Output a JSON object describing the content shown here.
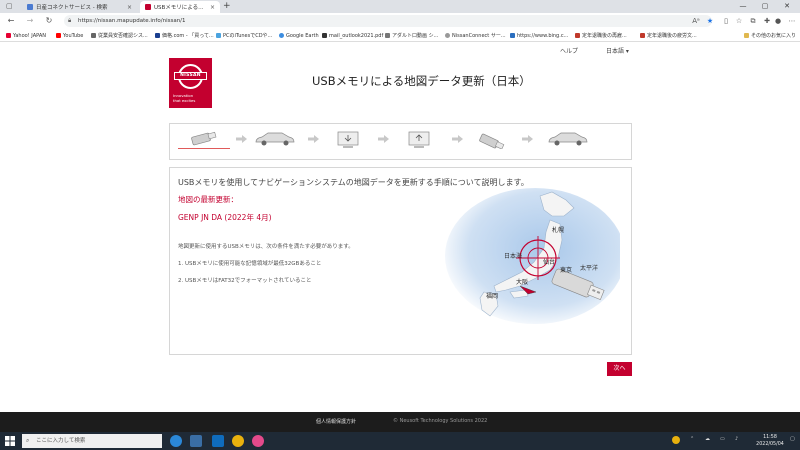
{
  "browser": {
    "tabs": [
      {
        "title": "日産コネクトサービス - 検索"
      },
      {
        "title": "USBメモリによる地図データ更新（日…"
      }
    ],
    "new_tab": "+",
    "url": "https://nissan.mapupdate.info/nissan/1",
    "bookmarks": [
      {
        "label": "Yahoo! JAPAN",
        "color": "#e60033"
      },
      {
        "label": "YouTube",
        "color": "#ff0000"
      },
      {
        "label": "従業員安否確認シス...",
        "color": "#666666"
      },
      {
        "label": "価格.com - 「買って...",
        "color": "#1a3f8f"
      },
      {
        "label": "PCのiTunesでCDや...",
        "color": "#4aa3df"
      },
      {
        "label": "Google Earth",
        "color": "#3c8de0"
      },
      {
        "label": "mail_outlook2021.pdf",
        "color": "#333333"
      },
      {
        "label": "アダルト口動画 シ...",
        "color": "#777777"
      },
      {
        "label": "NissanConnect サー...",
        "color": "#999999"
      },
      {
        "label": "https://www.bing.c...",
        "color": "#2a6ebf"
      },
      {
        "label": "定年退職後の再雇...",
        "color": "#c0392b"
      },
      {
        "label": "定年退職後の疲労文...",
        "color": "#c0392b"
      },
      {
        "label": "その他のお気に入り",
        "color": "#e0b84f"
      }
    ]
  },
  "page": {
    "help": "ヘルプ",
    "language": "日本語 ▾",
    "logo": {
      "brand": "NISSAN",
      "tagline_1": "Innovation",
      "tagline_2": "that excites"
    },
    "title": "USBメモリによる地図データ更新（日本）",
    "content": {
      "lead": "USBメモリを使用してナビゲーションシステムの地図データを更新する手順について説明します。",
      "update_label": "地図の最新更新：",
      "version": "GENP JN DA (2022年 4月)",
      "requirements_intro": "地図更新に使用するUSBメモリは、次の条件を満たす必要があります。",
      "requirement_1": "1. USBメモリに使用可能な記憶領域が最低32GBあること",
      "requirement_2": "2. USBメモリはFAT32でフォーマットされていること"
    },
    "map_labels": {
      "sapporo": "札幌",
      "sendai": "仙台",
      "tokyo": "東京",
      "osaka": "大阪",
      "fukuoka": "福岡",
      "sea_of_japan": "日本海",
      "pacific": "太平洋"
    },
    "next_button": "次へ",
    "footer": {
      "privacy": "個人情報保護方針",
      "copyright": "© Neusoft Technology Solutions 2022"
    }
  },
  "taskbar": {
    "search_placeholder": "ここに入力して検索",
    "clock_time": "11:58",
    "clock_date": "2022/05/04"
  },
  "colors": {
    "nissan_red": "#c3002f",
    "footer_bg": "#1c1c1c",
    "taskbar_bg": "#1f2a36"
  }
}
